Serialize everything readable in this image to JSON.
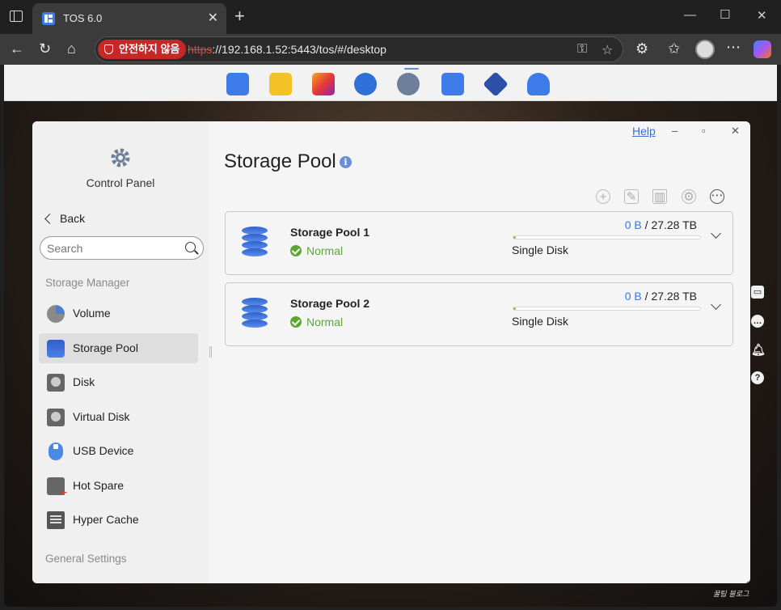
{
  "browser": {
    "tab_title": "TOS 6.0",
    "security_label": "안전하지 않음",
    "url_scheme": "https",
    "url_rest": "://192.168.1.52:5443/tos/#/desktop"
  },
  "app": {
    "title": "Control Panel",
    "back_label": "Back",
    "search_placeholder": "Search",
    "help_label": "Help",
    "page_title": "Storage Pool"
  },
  "sidebar": {
    "sections": [
      {
        "label": "Storage Manager"
      },
      {
        "label": "General Settings"
      }
    ],
    "items": [
      {
        "label": "Volume",
        "icon": "volume-pie-icon"
      },
      {
        "label": "Storage Pool",
        "icon": "storage-pool-icon",
        "active": true
      },
      {
        "label": "Disk",
        "icon": "disk-icon"
      },
      {
        "label": "Virtual Disk",
        "icon": "virtual-disk-icon"
      },
      {
        "label": "USB Device",
        "icon": "usb-device-icon"
      },
      {
        "label": "Hot Spare",
        "icon": "hot-spare-icon"
      },
      {
        "label": "Hyper Cache",
        "icon": "hyper-cache-icon"
      }
    ]
  },
  "pools": [
    {
      "name": "Storage Pool 1",
      "status": "Normal",
      "used": "0 B",
      "separator": "/",
      "total": "27.28 TB",
      "type": "Single Disk",
      "used_fraction": 0.01
    },
    {
      "name": "Storage Pool 2",
      "status": "Normal",
      "used": "0 B",
      "separator": "/",
      "total": "27.28 TB",
      "type": "Single Disk",
      "used_fraction": 0.01
    }
  ],
  "colors": {
    "accent": "#3b78d8",
    "status_ok": "#5aa832",
    "bar_fill": "#8cc63f",
    "insecure": "#c62828"
  },
  "watermark": "꿀팁 블로그"
}
